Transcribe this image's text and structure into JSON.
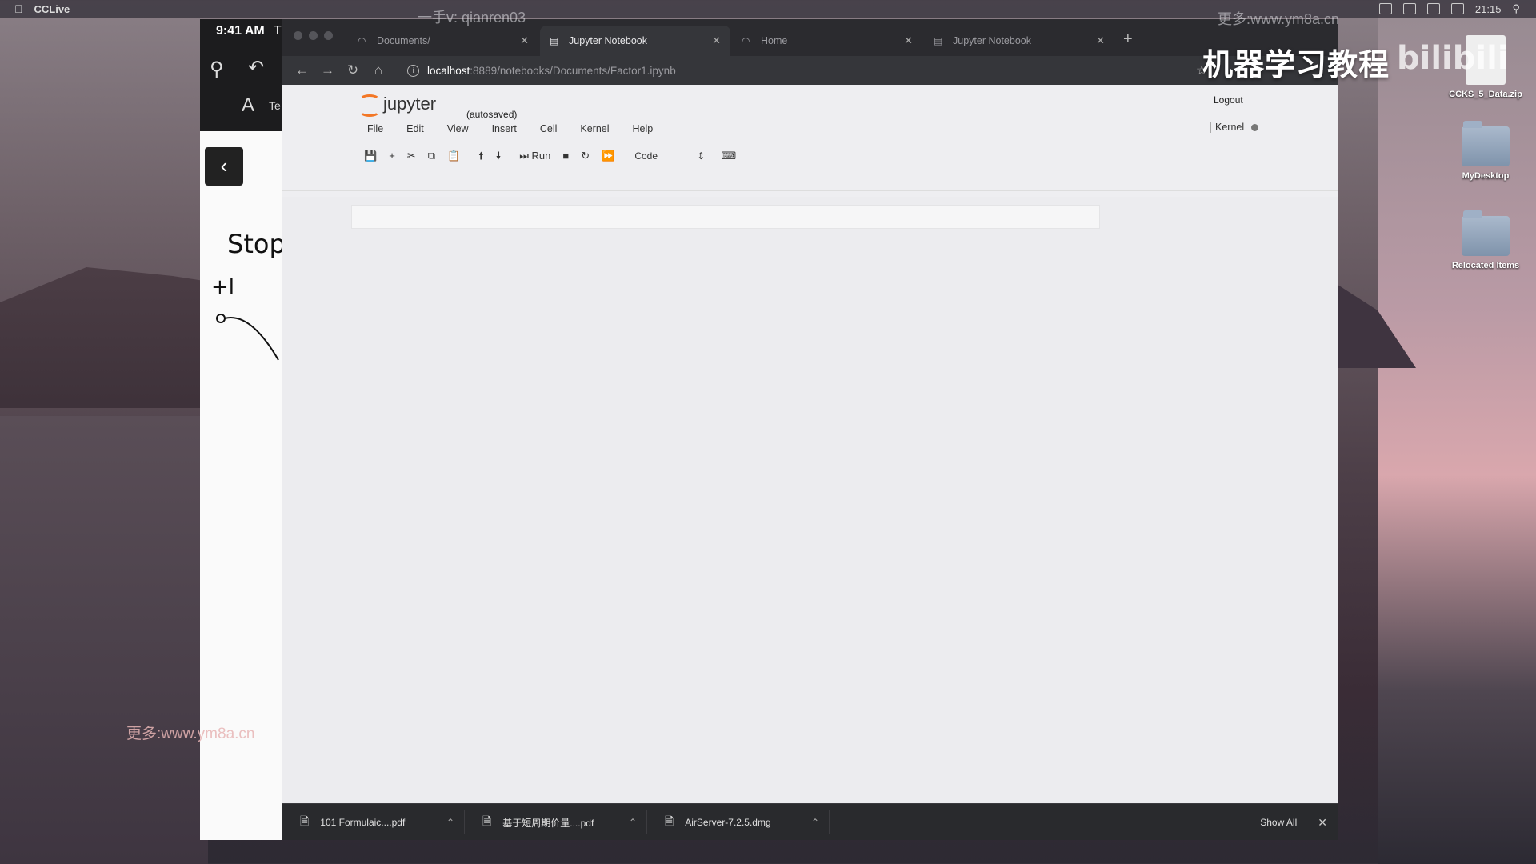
{
  "menubar": {
    "app_name": "CCLive",
    "time": "21:15"
  },
  "watermarks": {
    "top": "一手v: qianren03",
    "top_right": "更多:www.ym8a.cn",
    "bottom": "更多:www.ym8a.cn"
  },
  "channel": {
    "title": "机器学习教程",
    "logo": "bilibili"
  },
  "desktop_icons": [
    {
      "label": "CCKS_5_Data.zip",
      "icon": "zip-file-icon"
    },
    {
      "label": "MyDesktop",
      "icon": "folder-icon"
    },
    {
      "label": "Relocated Items",
      "icon": "folder-icon"
    }
  ],
  "ipad": {
    "time": "9:41 AM",
    "tab_label": "T",
    "text_tool_label": "A",
    "text_tool_suffix": "Te",
    "handwriting": [
      "Stop",
      "+l"
    ]
  },
  "browser": {
    "tabs": [
      {
        "title": "Documents/",
        "icon": "loading-icon",
        "active": false
      },
      {
        "title": "Jupyter Notebook",
        "icon": "notebook-icon",
        "active": true
      },
      {
        "title": "Home",
        "icon": "loading-icon",
        "active": false
      },
      {
        "title": "Jupyter Notebook",
        "icon": "notebook-icon",
        "active": false
      }
    ],
    "url_host": "localhost",
    "url_path": ":8889/notebooks/Documents/Factor1.ipynb"
  },
  "jupyter": {
    "logo_text": "jupyter",
    "autosaved": "(autosaved)",
    "logout": "Logout",
    "menus": [
      "File",
      "Edit",
      "View",
      "Insert",
      "Cell",
      "Kernel",
      "Help"
    ],
    "kernel_label": "Kernel",
    "toolbar": {
      "run_label": "Run",
      "cell_type": "Code"
    }
  },
  "downloads": {
    "items": [
      {
        "name": "101 Formulaic....pdf"
      },
      {
        "name": "基于短周期价量....pdf"
      },
      {
        "name": "AirServer-7.2.5.dmg"
      }
    ],
    "show_all": "Show All"
  }
}
